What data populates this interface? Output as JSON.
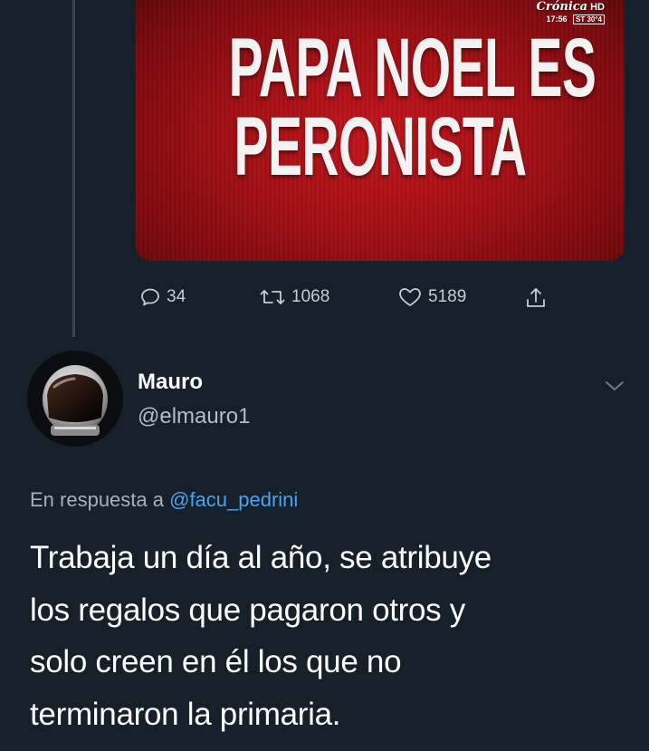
{
  "original_tweet": {
    "media": {
      "headline_line1": "PAPA NOEL ES",
      "headline_line2": "PERONISTA",
      "channel": {
        "name": "Crónica",
        "quality": "HD",
        "time": "17:56",
        "temperature_label": "ST",
        "temperature": "30°4"
      },
      "background_color": "#b5121a"
    },
    "actions": {
      "replies": {
        "icon": "reply-icon",
        "count": "34"
      },
      "retweets": {
        "icon": "retweet-icon",
        "count": "1068"
      },
      "likes": {
        "icon": "heart-icon",
        "count": "5189"
      },
      "share": {
        "icon": "share-icon"
      }
    }
  },
  "reply_tweet": {
    "author": {
      "name": "Mauro",
      "handle": "@elmauro1",
      "avatar": "astronaut-helmet-avatar"
    },
    "more_icon": "chevron-down-icon",
    "in_reply_to": {
      "prefix": "En respuesta a",
      "mention": "@facu_pedrini"
    },
    "text_lines": [
      "Trabaja un día al año, se atribuye",
      "los regalos que pagaron otros y",
      "solo creen en él los que no",
      "terminaron la primaria."
    ]
  },
  "colors": {
    "background": "#15202b",
    "mention": "#4aa3ee",
    "secondary_text": "#a7b0b9",
    "thread_line": "#3a4653"
  }
}
